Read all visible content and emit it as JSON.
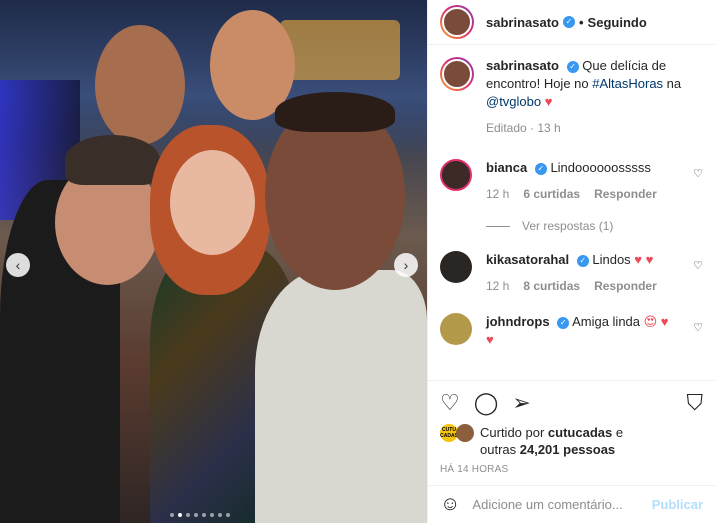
{
  "header": {
    "username": "sabrinasato",
    "follow_status": "Seguindo"
  },
  "caption": {
    "username": "sabrinasato",
    "text_before": "Que delícia de encontro! Hoje no ",
    "hashtag": "#AltasHoras",
    "text_mid": " na ",
    "mention": "@tvglobo",
    "emoji": "♥",
    "edited": "Editado",
    "time": "13 h"
  },
  "comments": [
    {
      "username": "bianca",
      "text": "Lindoooooosssss",
      "time": "12 h",
      "likes": "6 curtidas",
      "reply": "Responder",
      "view_replies": "Ver respostas (1)"
    },
    {
      "username": "kikasatorahal",
      "text": "Lindos",
      "emoji": "♥ ♥",
      "time": "12 h",
      "likes": "8 curtidas",
      "reply": "Responder"
    },
    {
      "username": "johndrops",
      "text": "Amiga linda",
      "emoji": "😍 ♥",
      "emoji2": "♥"
    }
  ],
  "likes_summary": {
    "line1_prefix": "Curtido por ",
    "liker": "cutucadas",
    "line1_suffix": " e",
    "line2_prefix": "outras ",
    "count": "24,201 pessoas",
    "mini_avatar_text": "CUTU CADAS"
  },
  "timestamp": "HÁ 14 HORAS",
  "add_comment": {
    "placeholder": "Adicione um comentário...",
    "publish": "Publicar"
  },
  "icons": {
    "like": "heart-icon",
    "comment": "comment-icon",
    "share": "share-icon",
    "save": "bookmark-icon",
    "emoji": "emoji-icon",
    "prev": "chevron-left-icon",
    "next": "chevron-right-icon"
  },
  "colors": {
    "accent": "#0095f6",
    "verified": "#3897f0",
    "heart": "#ed4956",
    "link": "#00376b",
    "muted": "#8e8e8e"
  }
}
